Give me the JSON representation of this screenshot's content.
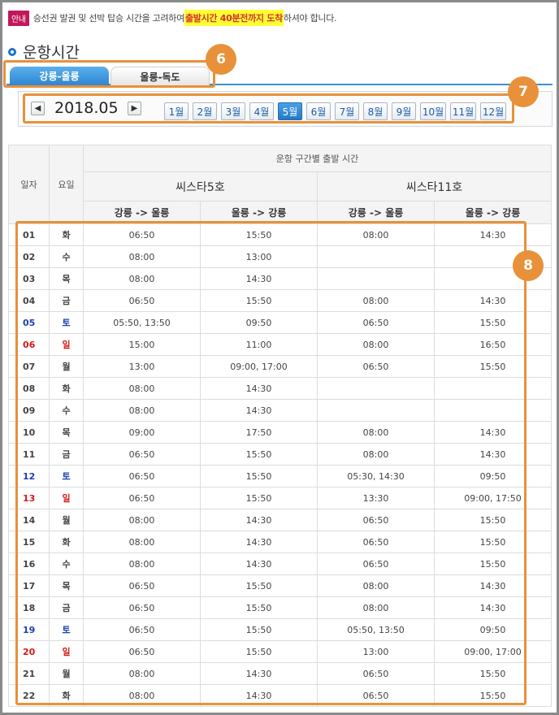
{
  "notice": {
    "badge": "안내",
    "text_before": "승선권 발권 및 선박 탑승 시간을 고려하여 ",
    "highlight": "출발시간 40분전까지 도착",
    "text_after": "하셔야 합니다."
  },
  "section_title": "운항시간",
  "tabs": [
    {
      "label": "강릉-울릉",
      "active": true
    },
    {
      "label": "울릉-독도",
      "active": false
    }
  ],
  "callouts": [
    "6",
    "7",
    "8"
  ],
  "year_month": {
    "label": "2018.05",
    "prev_icon": "chevron-left-icon",
    "next_icon": "chevron-right-icon",
    "months": [
      "1월",
      "2월",
      "3월",
      "4월",
      "5월",
      "6월",
      "7월",
      "8월",
      "9월",
      "10월",
      "11월",
      "12월"
    ],
    "selected_month": "5월"
  },
  "table": {
    "col_day": "일자",
    "col_weekday": "요일",
    "group_header": "운항 구간별 출발 시간",
    "ships": [
      "씨스타5호",
      "씨스타11호"
    ],
    "routes": [
      "강릉 -> 울릉",
      "울릉 -> 강릉",
      "강릉 -> 울릉",
      "울릉 -> 강릉"
    ],
    "rows": [
      {
        "day": "01",
        "weekday": "화",
        "type": "weekday",
        "times": [
          "06:50",
          "15:50",
          "08:00",
          "14:30"
        ]
      },
      {
        "day": "02",
        "weekday": "수",
        "type": "weekday",
        "times": [
          "08:00",
          "13:00",
          "",
          ""
        ]
      },
      {
        "day": "03",
        "weekday": "목",
        "type": "weekday",
        "times": [
          "08:00",
          "14:30",
          "",
          ""
        ]
      },
      {
        "day": "04",
        "weekday": "금",
        "type": "weekday",
        "times": [
          "06:50",
          "15:50",
          "08:00",
          "14:30"
        ]
      },
      {
        "day": "05",
        "weekday": "토",
        "type": "sat",
        "times": [
          "05:50, 13:50",
          "09:50",
          "06:50",
          "15:50"
        ]
      },
      {
        "day": "06",
        "weekday": "일",
        "type": "sun",
        "times": [
          "15:00",
          "11:00",
          "08:00",
          "16:50"
        ]
      },
      {
        "day": "07",
        "weekday": "월",
        "type": "weekday",
        "times": [
          "13:00",
          "09:00, 17:00",
          "06:50",
          "15:50"
        ]
      },
      {
        "day": "08",
        "weekday": "화",
        "type": "weekday",
        "times": [
          "08:00",
          "14:30",
          "",
          ""
        ]
      },
      {
        "day": "09",
        "weekday": "수",
        "type": "weekday",
        "times": [
          "08:00",
          "14:30",
          "",
          ""
        ]
      },
      {
        "day": "10",
        "weekday": "목",
        "type": "weekday",
        "times": [
          "09:00",
          "17:50",
          "08:00",
          "14:30"
        ]
      },
      {
        "day": "11",
        "weekday": "금",
        "type": "weekday",
        "times": [
          "06:50",
          "15:50",
          "08:00",
          "14:30"
        ]
      },
      {
        "day": "12",
        "weekday": "토",
        "type": "sat",
        "times": [
          "06:50",
          "15:50",
          "05:30, 14:30",
          "09:50"
        ]
      },
      {
        "day": "13",
        "weekday": "일",
        "type": "sun",
        "times": [
          "06:50",
          "15:50",
          "13:30",
          "09:00, 17:50"
        ]
      },
      {
        "day": "14",
        "weekday": "월",
        "type": "weekday",
        "times": [
          "08:00",
          "14:30",
          "06:50",
          "15:50"
        ]
      },
      {
        "day": "15",
        "weekday": "화",
        "type": "weekday",
        "times": [
          "08:00",
          "14:30",
          "06:50",
          "15:50"
        ]
      },
      {
        "day": "16",
        "weekday": "수",
        "type": "weekday",
        "times": [
          "08:00",
          "14:30",
          "06:50",
          "15:50"
        ]
      },
      {
        "day": "17",
        "weekday": "목",
        "type": "weekday",
        "times": [
          "06:50",
          "15:50",
          "08:00",
          "14:30"
        ]
      },
      {
        "day": "18",
        "weekday": "금",
        "type": "weekday",
        "times": [
          "06:50",
          "15:50",
          "08:00",
          "14:30"
        ]
      },
      {
        "day": "19",
        "weekday": "토",
        "type": "sat",
        "times": [
          "06:50",
          "15:50",
          "05:50, 13:50",
          "09:50"
        ]
      },
      {
        "day": "20",
        "weekday": "일",
        "type": "sun",
        "times": [
          "06:50",
          "15:50",
          "13:00",
          "09:00, 17:00"
        ]
      },
      {
        "day": "21",
        "weekday": "월",
        "type": "weekday",
        "times": [
          "08:00",
          "14:30",
          "06:50",
          "15:50"
        ]
      },
      {
        "day": "22",
        "weekday": "화",
        "type": "weekday",
        "times": [
          "08:00",
          "14:30",
          "06:50",
          "15:50"
        ]
      }
    ]
  },
  "colors": {
    "accent": "#2f86d2",
    "callout": "#e8913a",
    "saturday": "#1a3fb3",
    "sunday": "#d11a1a",
    "highlight": "#ffff33"
  }
}
